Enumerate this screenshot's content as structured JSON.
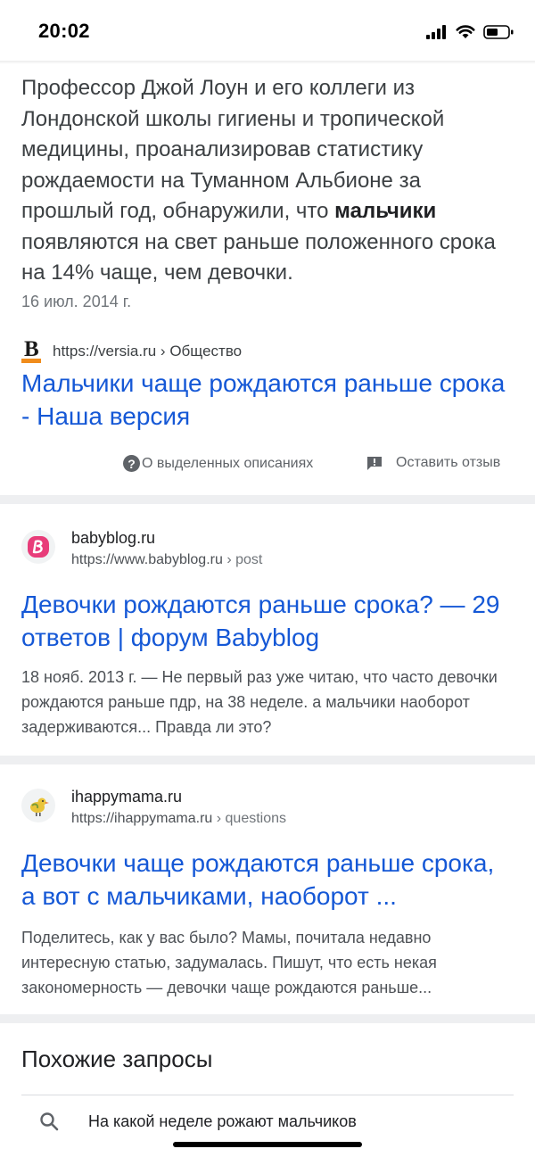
{
  "status": {
    "time": "20:02"
  },
  "featured": {
    "snippet_before": "Профессор Джой Лоун и его коллеги из Лондонской школы гигиены и тропической медицины, проанализировав статистику рождаемости на Туманном Альбионе за прошлый год, обнаружили, что ",
    "snippet_bold": "мальчики",
    "snippet_after": " появляются на свет раньше положенного срока на 14% чаще, чем девочки.",
    "date": "16 июл. 2014 г.",
    "source_logo_letter": "B",
    "source_url": "https://versia.ru › Общество",
    "title": "Мальчики чаще рождаются раньше срока - Наша версия",
    "about_label": "О выделенных описаниях",
    "feedback_label": "Оставить отзыв"
  },
  "results": [
    {
      "site": "babyblog.ru",
      "url": "https://www.babyblog.ru",
      "path": " › post",
      "title": "Девочки рождаются раньше срока? — 29 ответов | форум Babyblog",
      "description": "18 нояб. 2013 г. — Не первый раз уже читаю, что часто девочки рождаются раньше пдр, на 38 неделе. а мальчики наоборот задерживаются... Правда ли это?"
    },
    {
      "site": "ihappymama.ru",
      "url": "https://ihappymama.ru",
      "path": " › questions",
      "title": "Девочки чаще рождаются раньше срока, а вот с мальчиками, наоборот ...",
      "description": "Поделитесь, как у вас было? Мамы, почитала недавно интересную статью, задумалась. Пишут, что есть некая закономерность — девочки чаще рождаются раньше..."
    }
  ],
  "related": {
    "title": "Похожие запросы",
    "items": [
      "На какой неделе рожают мальчиков"
    ]
  },
  "colors": {
    "link": "#1558d6",
    "text": "#202124",
    "muted": "#70757a",
    "divider": "#eeeff1"
  }
}
